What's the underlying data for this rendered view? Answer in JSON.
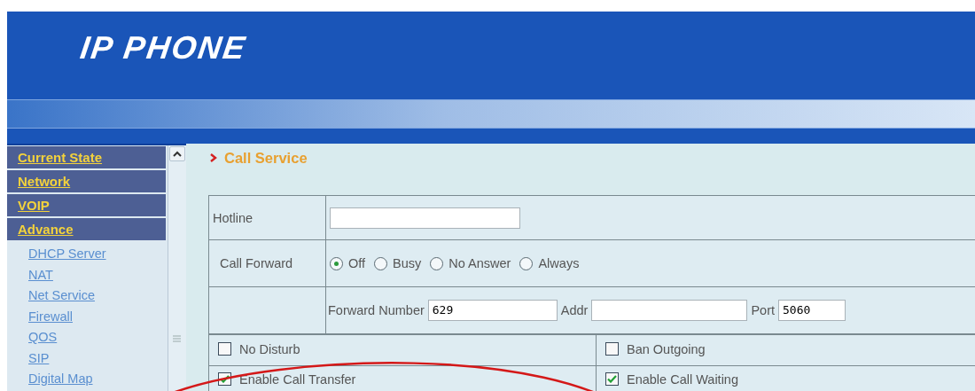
{
  "header": {
    "title": "IP PHONE"
  },
  "sidebar": {
    "sections": [
      {
        "label": "Current State"
      },
      {
        "label": "Network"
      },
      {
        "label": "VOIP"
      },
      {
        "label": "Advance",
        "children": [
          {
            "label": "DHCP Server"
          },
          {
            "label": "NAT"
          },
          {
            "label": "Net Service"
          },
          {
            "label": "Firewall"
          },
          {
            "label": "QOS"
          },
          {
            "label": "SIP"
          },
          {
            "label": "Digital Map"
          }
        ]
      }
    ]
  },
  "page": {
    "title": "Call Service"
  },
  "form": {
    "hotline": {
      "label": "Hotline"
    },
    "call_forward": {
      "label": "Call Forward",
      "options": [
        {
          "label": "Off",
          "selected": true
        },
        {
          "label": "Busy",
          "selected": false
        },
        {
          "label": "No Answer",
          "selected": false
        },
        {
          "label": "Always",
          "selected": false
        }
      ]
    },
    "forward": {
      "number_label": "Forward Number",
      "number": "629",
      "addr_label": "Addr",
      "port_label": "Port",
      "port": "5060"
    },
    "options": [
      {
        "label": "No Disturb",
        "checked": false
      },
      {
        "label": "Ban Outgoing",
        "checked": false
      },
      {
        "label": "Enable Call Transfer",
        "checked": true
      },
      {
        "label": "Enable Call Waiting",
        "checked": true
      }
    ]
  }
}
